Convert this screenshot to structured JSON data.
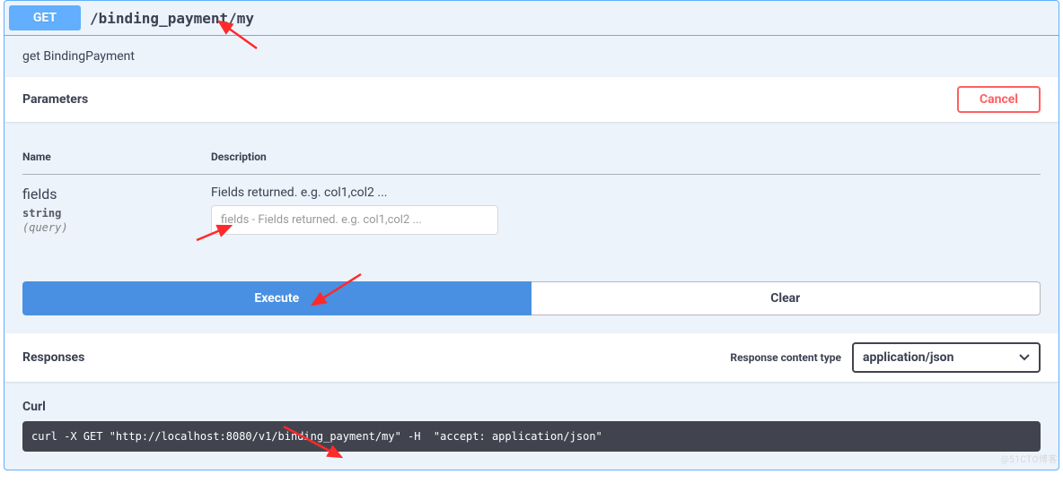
{
  "operation": {
    "method": "GET",
    "path": "/binding_payment/my",
    "summary": "get BindingPayment"
  },
  "parameters_section": {
    "title": "Parameters",
    "cancel_label": "Cancel",
    "headers": {
      "name": "Name",
      "description": "Description"
    },
    "params": [
      {
        "name": "fields",
        "type": "string",
        "in": "(query)",
        "description": "Fields returned. e.g. col1,col2 ...",
        "placeholder": "fields - Fields returned. e.g. col1,col2 ...",
        "value": ""
      }
    ]
  },
  "actions": {
    "execute_label": "Execute",
    "clear_label": "Clear"
  },
  "responses_section": {
    "title": "Responses",
    "content_type_label": "Response content type",
    "content_type_value": "application/json"
  },
  "curl_section": {
    "title": "Curl",
    "command": "curl -X GET \"http://localhost:8080/v1/binding_payment/my\" -H  \"accept: application/json\""
  },
  "watermark": "@51CTO博客"
}
